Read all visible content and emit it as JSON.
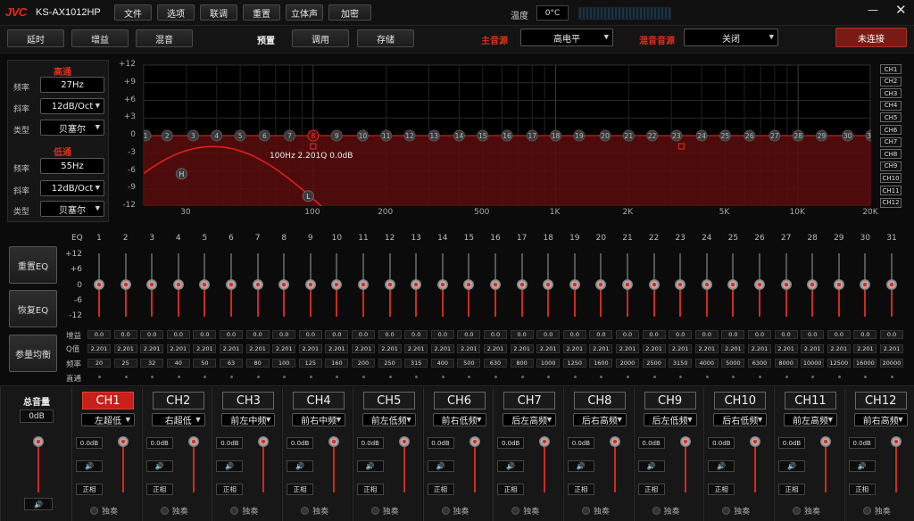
{
  "title": {
    "logo": "JVC",
    "model": "KS-AX1012HP",
    "min": "—",
    "close": "✕"
  },
  "menu": [
    "文件",
    "选项",
    "联调",
    "重置",
    "立体声",
    "加密"
  ],
  "temperature": {
    "label": "温度",
    "value": "0°C"
  },
  "toolbar": {
    "delay": "延时",
    "gain": "增益",
    "mix": "混音",
    "preset": "预置",
    "recall": "调用",
    "save": "存储"
  },
  "source": {
    "label": "主音源",
    "value": "高电平"
  },
  "mix_source": {
    "label": "混音音源",
    "value": "关闭"
  },
  "connect": "未连接",
  "crossover": {
    "high": {
      "title": "高通",
      "freq_label": "频率",
      "freq": "27Hz",
      "slope_label": "斜率",
      "slope": "12dB/Oct",
      "type_label": "类型",
      "type": "贝塞尔"
    },
    "low": {
      "title": "低通",
      "freq_label": "频率",
      "freq": "55Hz",
      "slope_label": "斜率",
      "slope": "12dB/Oct",
      "type_label": "类型",
      "type": "贝塞尔"
    }
  },
  "graph": {
    "y_ticks": [
      "+12",
      "+9",
      "+6",
      "+3",
      "0",
      "-3",
      "-6",
      "-9",
      "-12"
    ],
    "x_ticks": [
      "30",
      "100",
      "200",
      "500",
      "1K",
      "2K",
      "5K",
      "10K",
      "20K"
    ],
    "selected_info": "100Hz  2.201Q  0.0dB",
    "selected_band": "8",
    "high_marker": "H",
    "low_marker": "L",
    "channels": [
      "CH1",
      "CH2",
      "CH3",
      "CH4",
      "CH5",
      "CH6",
      "CH7",
      "CH8",
      "CH9",
      "CH10",
      "CH11",
      "CH12"
    ],
    "accent": "#e0301e"
  },
  "eq": {
    "label": "EQ",
    "y_ticks": [
      "+12",
      "+6",
      "0",
      "-6",
      "-12"
    ],
    "reset_button": "重置EQ",
    "restore_button": "恢复EQ",
    "param_button": "参量均衡",
    "row_labels": {
      "gain": "增益",
      "q": "Q值",
      "freq": "频率",
      "bypass": "直通"
    },
    "bands": [
      "1",
      "2",
      "3",
      "4",
      "5",
      "6",
      "7",
      "8",
      "9",
      "10",
      "11",
      "12",
      "13",
      "14",
      "15",
      "16",
      "17",
      "18",
      "19",
      "20",
      "21",
      "22",
      "23",
      "24",
      "25",
      "26",
      "27",
      "28",
      "29",
      "30",
      "31"
    ],
    "gains": [
      "0.0",
      "0.0",
      "0.0",
      "0.0",
      "0.0",
      "0.0",
      "0.0",
      "0.0",
      "0.0",
      "0.0",
      "0.0",
      "0.0",
      "0.0",
      "0.0",
      "0.0",
      "0.0",
      "0.0",
      "0.0",
      "0.0",
      "0.0",
      "0.0",
      "0.0",
      "0.0",
      "0.0",
      "0.0",
      "0.0",
      "0.0",
      "0.0",
      "0.0",
      "0.0",
      "0.0"
    ],
    "qs": [
      "2.201",
      "2.201",
      "2.201",
      "2.201",
      "2.201",
      "2.201",
      "2.201",
      "2.201",
      "2.201",
      "2.201",
      "2.201",
      "2.201",
      "2.201",
      "2.201",
      "2.201",
      "2.201",
      "2.201",
      "2.201",
      "2.201",
      "2.201",
      "2.201",
      "2.201",
      "2.201",
      "2.201",
      "2.201",
      "2.201",
      "2.201",
      "2.201",
      "2.201",
      "2.201",
      "2.201"
    ],
    "freqs": [
      "20",
      "25",
      "32",
      "40",
      "50",
      "63",
      "80",
      "100",
      "125",
      "160",
      "200",
      "250",
      "315",
      "400",
      "500",
      "630",
      "800",
      "1000",
      "1250",
      "1600",
      "2000",
      "2500",
      "3150",
      "4000",
      "5000",
      "6300",
      "8000",
      "10000",
      "12500",
      "16000",
      "20000"
    ]
  },
  "master": {
    "label": "总音量",
    "value": "0dB",
    "speaker_icon": "🔊"
  },
  "channels": [
    {
      "name": "CH1",
      "assign": "左超低",
      "level": "0.0dB",
      "phase": "正相",
      "solo": "独奏"
    },
    {
      "name": "CH2",
      "assign": "右超低",
      "level": "0.0dB",
      "phase": "正相",
      "solo": "独奏"
    },
    {
      "name": "CH3",
      "assign": "前左中频",
      "level": "0.0dB",
      "phase": "正相",
      "solo": "独奏"
    },
    {
      "name": "CH4",
      "assign": "前右中频",
      "level": "0.0dB",
      "phase": "正相",
      "solo": "独奏"
    },
    {
      "name": "CH5",
      "assign": "前左低频",
      "level": "0.0dB",
      "phase": "正相",
      "solo": "独奏"
    },
    {
      "name": "CH6",
      "assign": "前右低频",
      "level": "0.0dB",
      "phase": "正相",
      "solo": "独奏"
    },
    {
      "name": "CH7",
      "assign": "后左高频",
      "level": "0.0dB",
      "phase": "正相",
      "solo": "独奏"
    },
    {
      "name": "CH8",
      "assign": "后右高频",
      "level": "0.0dB",
      "phase": "正相",
      "solo": "独奏"
    },
    {
      "name": "CH9",
      "assign": "后左低频",
      "level": "0.0dB",
      "phase": "正相",
      "solo": "独奏"
    },
    {
      "name": "CH10",
      "assign": "后右低频",
      "level": "0.0dB",
      "phase": "正相",
      "solo": "独奏"
    },
    {
      "name": "CH11",
      "assign": "前左高频",
      "level": "0.0dB",
      "phase": "正相",
      "solo": "独奏"
    },
    {
      "name": "CH12",
      "assign": "前右高频",
      "level": "0.0dB",
      "phase": "正相",
      "solo": "独奏"
    }
  ],
  "active_channel": "CH1"
}
